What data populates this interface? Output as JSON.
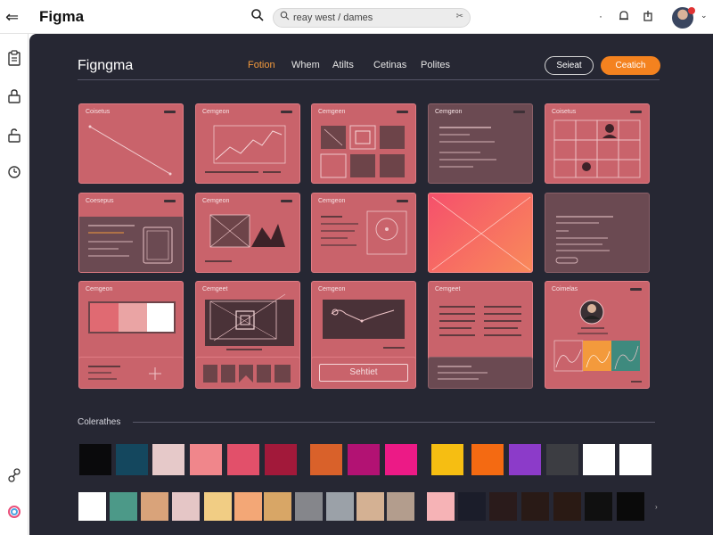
{
  "window": {
    "title": "Figma"
  },
  "search": {
    "value": "reay west / dames"
  },
  "canvas_header": {
    "brand": "Figngma",
    "nav": [
      "Fotion",
      "Whem",
      "Atilts",
      "Cetinas",
      "Polites"
    ],
    "active_nav": 0,
    "outline_button": "Seieat",
    "primary_button": "Ceatich"
  },
  "cards": [
    {
      "title": "Coisetus",
      "style": "pink",
      "kind": "diagonal"
    },
    {
      "title": "Cemgeon",
      "style": "pink",
      "kind": "line-chart"
    },
    {
      "title": "Cemgeen",
      "style": "pink",
      "kind": "grid-icons"
    },
    {
      "title": "Cemgeon",
      "style": "dark",
      "kind": "text-lines"
    },
    {
      "title": "Coisetus",
      "style": "pink",
      "kind": "grid-figures"
    },
    {
      "title": "Coesepus",
      "style": "dark-top",
      "kind": "sketch-frame"
    },
    {
      "title": "Cemgeon",
      "style": "pink",
      "kind": "image-placeholder"
    },
    {
      "title": "Cemgeon",
      "style": "pink",
      "kind": "text-circle"
    },
    {
      "title": "",
      "style": "gradient",
      "kind": "cross"
    },
    {
      "title": "",
      "style": "dark",
      "kind": "form-lines"
    },
    {
      "title": "Cemgeon",
      "style": "pink",
      "kind": "color-bar"
    },
    {
      "title": "Cemgeet",
      "style": "pink",
      "kind": "frame-icon"
    },
    {
      "title": "Cemgeon",
      "style": "pink",
      "kind": "path-chart"
    },
    {
      "title": "Cemgeet",
      "style": "pink",
      "kind": "columns"
    },
    {
      "title": "Coimelas",
      "style": "pink",
      "kind": "profile"
    }
  ],
  "bottom_cards": [
    {
      "kind": "plus"
    },
    {
      "kind": "squares"
    },
    {
      "kind": "button",
      "label": "Sehtiet"
    },
    {
      "kind": "lines"
    },
    {
      "kind": "plain"
    }
  ],
  "colors_section": {
    "label": "Colerathes"
  },
  "swatches_row1": [
    "#0a0a0c",
    "#14475e",
    "#e6c9c9",
    "#f0868b",
    "#e2506a",
    "#a2193a",
    "#d9612a",
    "#b21273",
    "#ec1a86",
    "#f6be12",
    "#f46a12",
    "#8c3bc9",
    "#3c3d42",
    "#ffffff",
    "#ffffff"
  ],
  "swatches_row2": [
    "#ffffff",
    "#4c9988",
    "#d9a37a",
    "#e5c6c6",
    "#f1cd84",
    "#f3a776",
    "#d8a666",
    "#85868b",
    "#9ba1a8",
    "#d4b193",
    "#b39d8d",
    "#f6b3b6",
    "#1b1d2a",
    "#2a1b1b",
    "#291a16",
    "#2a1a14",
    "#101010",
    "#0a0a0a"
  ],
  "more_label": "›"
}
